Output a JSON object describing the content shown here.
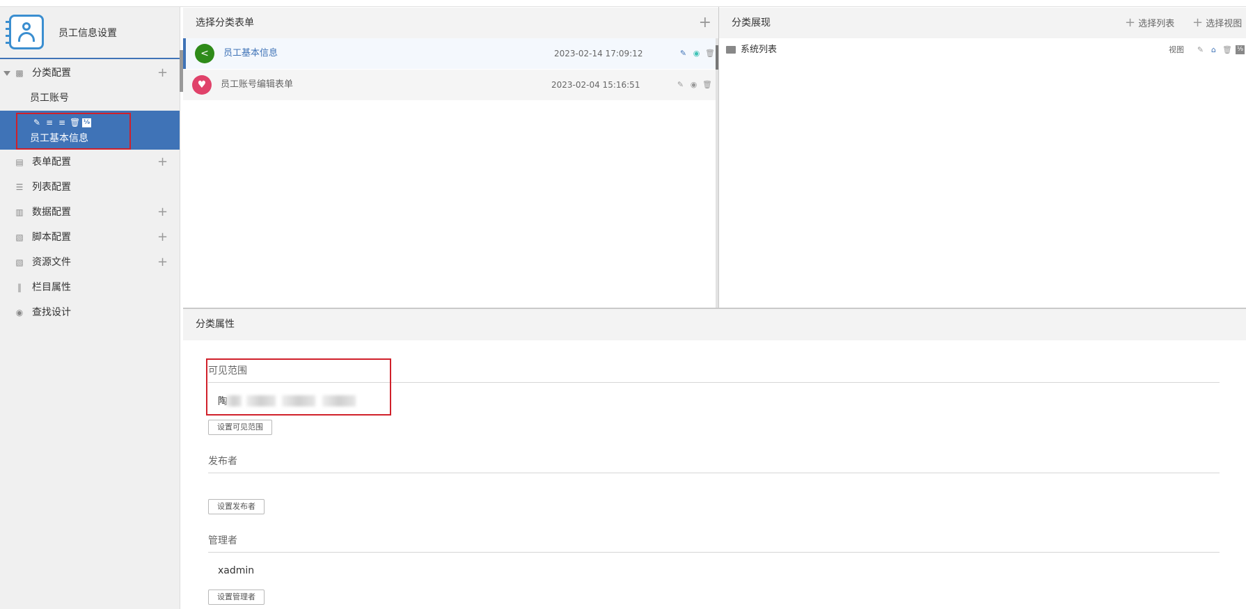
{
  "app": {
    "title": "员工信息设置"
  },
  "sidebar": {
    "items": [
      {
        "label": "分类配置",
        "icon": "category-icon",
        "has_add": true,
        "expanded": true
      },
      {
        "label": "表单配置",
        "icon": "form-icon",
        "has_add": true
      },
      {
        "label": "列表配置",
        "icon": "list-icon",
        "has_add": false
      },
      {
        "label": "数据配置",
        "icon": "chart-icon",
        "has_add": true
      },
      {
        "label": "脚本配置",
        "icon": "script-icon",
        "has_add": true
      },
      {
        "label": "资源文件",
        "icon": "resource-icon",
        "has_add": true
      },
      {
        "label": "栏目属性",
        "icon": "sliders-icon",
        "has_add": false
      },
      {
        "label": "查找设计",
        "icon": "binoculars-icon",
        "has_add": false
      }
    ],
    "sub_items": [
      {
        "label": "员工账号"
      },
      {
        "label": "员工基本信息",
        "selected": true
      }
    ],
    "selected_badge": "⅑"
  },
  "forms_panel": {
    "title": "选择分类表单",
    "rows": [
      {
        "name": "员工基本信息",
        "date": "2023-02-14 17:09:12",
        "avatar_color": "#2e8b1a",
        "name_color": "#3f73b7",
        "selected": true
      },
      {
        "name": "员工账号编辑表单",
        "date": "2023-02-04 15:16:51",
        "avatar_color": "#e0426a",
        "name_color": "#666",
        "selected": false
      }
    ]
  },
  "display_panel": {
    "title": "分类展现",
    "select_list_label": "选择列表",
    "select_view_label": "选择视图",
    "rows": [
      {
        "name": "系统列表",
        "view_label": "视图"
      }
    ]
  },
  "properties": {
    "title": "分类属性",
    "visible_range": {
      "label": "可见范围",
      "value_prefix": "陶",
      "button": "设置可见范围"
    },
    "publisher": {
      "label": "发布者",
      "button": "设置发布者"
    },
    "manager": {
      "label": "管理者",
      "value": "xadmin",
      "button": "设置管理者"
    }
  },
  "colors": {
    "accent": "#3f73b7",
    "highlight_box": "#d0202a"
  }
}
